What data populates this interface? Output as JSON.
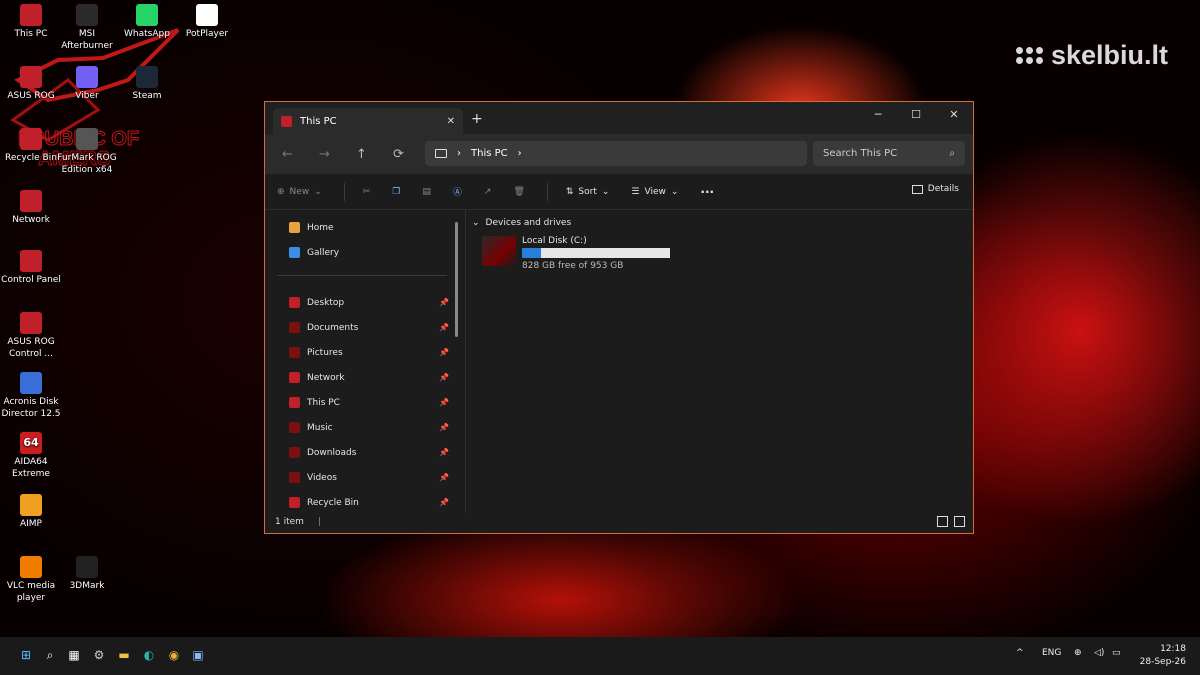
{
  "watermark": "skelbiu.lt",
  "desktop_icons": [
    {
      "label": "This PC",
      "icon": "computer-icon",
      "color": "#c0202a"
    },
    {
      "label": "MSI Afterburner",
      "icon": "msi-afterburner-icon",
      "color": "#2a2a2a"
    },
    {
      "label": "WhatsApp",
      "icon": "whatsapp-icon",
      "color": "#25d366"
    },
    {
      "label": "PotPlayer",
      "icon": "potplayer-icon",
      "color": "#ffffff"
    },
    {
      "label": "ASUS ROG",
      "icon": "asus-rog-icon",
      "color": "#c0202a"
    },
    {
      "label": "Viber",
      "icon": "viber-icon",
      "color": "#7360f2"
    },
    {
      "label": "Steam",
      "icon": "steam-icon",
      "color": "#1b2838"
    },
    {
      "label": "Recycle Bin",
      "icon": "recycle-bin-icon",
      "color": "#c0202a"
    },
    {
      "label": "FurMark ROG Edition x64",
      "icon": "furmark-icon",
      "color": "#555555"
    },
    {
      "label": "Network",
      "icon": "network-icon",
      "color": "#c0202a"
    },
    {
      "label": "Control Panel",
      "icon": "control-panel-icon",
      "color": "#c0202a"
    },
    {
      "label": "ASUS ROG Control ...",
      "icon": "rog-control-icon",
      "color": "#c0202a"
    },
    {
      "label": "Acronis Disk Director 12.5",
      "icon": "acronis-icon",
      "color": "#3a6fd8"
    },
    {
      "label": "AIDA64 Extreme",
      "icon": "aida64-icon",
      "color": "#c81e1e",
      "glyph": "64"
    },
    {
      "label": "AIMP",
      "icon": "aimp-icon",
      "color": "#f0a020"
    },
    {
      "label": "VLC media player",
      "icon": "vlc-icon",
      "color": "#f07d00"
    },
    {
      "label": "3DMark",
      "icon": "3dmark-icon",
      "color": "#222222"
    }
  ],
  "explorer": {
    "tab_title": "This PC",
    "new_tab": "+",
    "window_controls": {
      "minimize": "─",
      "maximize": "☐",
      "close": "✕"
    },
    "nav": {
      "back": "←",
      "forward": "→",
      "up": "↑",
      "refresh": "⟳"
    },
    "address": {
      "segment": "This PC",
      "sep": "›",
      "sep2": "›"
    },
    "search_placeholder": "Search This PC",
    "toolbar": {
      "new": "New",
      "sort": "Sort",
      "view": "View",
      "more": "···",
      "details": "Details"
    },
    "navpane": [
      {
        "label": "Home",
        "icon": "home-icon",
        "color": "#e8a33d",
        "pinned": false
      },
      {
        "label": "Gallery",
        "icon": "gallery-icon",
        "color": "#3a8ee6",
        "pinned": false
      },
      {
        "label": "Desktop",
        "icon": "desktop-icon",
        "color": "#c0202a",
        "pinned": true
      },
      {
        "label": "Documents",
        "icon": "documents-icon",
        "color": "#7a1010",
        "pinned": true
      },
      {
        "label": "Pictures",
        "icon": "pictures-icon",
        "color": "#7a1010",
        "pinned": true
      },
      {
        "label": "Network",
        "icon": "network-icon",
        "color": "#c0202a",
        "pinned": true
      },
      {
        "label": "This PC",
        "icon": "computer-icon",
        "color": "#c0202a",
        "pinned": true
      },
      {
        "label": "Music",
        "icon": "music-icon",
        "color": "#7a1010",
        "pinned": true
      },
      {
        "label": "Downloads",
        "icon": "downloads-icon",
        "color": "#7a1010",
        "pinned": true
      },
      {
        "label": "Videos",
        "icon": "videos-icon",
        "color": "#7a1010",
        "pinned": true
      },
      {
        "label": "Recycle Bin",
        "icon": "recycle-bin-icon",
        "color": "#c0202a",
        "pinned": true
      }
    ],
    "section": "Devices and drives",
    "drive": {
      "name": "Local Disk (C:)",
      "free_text": "828 GB free of 953 GB",
      "used_fraction": 0.131
    },
    "status": "1 item",
    "status_sep": "|"
  },
  "taskbar": {
    "apps": [
      {
        "icon": "start-icon",
        "glyph": "⊞",
        "color": "#4cc2ff"
      },
      {
        "icon": "search-icon",
        "glyph": "⌕",
        "color": "#ffffff"
      },
      {
        "icon": "widgets-icon",
        "glyph": "▦",
        "color": "#ffffff"
      },
      {
        "icon": "settings-icon",
        "glyph": "⚙",
        "color": "#cccccc"
      },
      {
        "icon": "file-explorer-icon",
        "glyph": "▬",
        "color": "#f3c043"
      },
      {
        "icon": "edge-icon",
        "glyph": "◐",
        "color": "#2fb5a5"
      },
      {
        "icon": "chrome-icon",
        "glyph": "◉",
        "color": "#e8b23a"
      },
      {
        "icon": "active-app-icon",
        "glyph": "▣",
        "color": "#8fb3ff"
      }
    ],
    "tray_chevron": "^",
    "language": "ENG",
    "tray_icons": [
      "network-tray-icon",
      "volume-icon",
      "battery-icon"
    ],
    "time": "12:18",
    "date": "28-Sep-26"
  }
}
